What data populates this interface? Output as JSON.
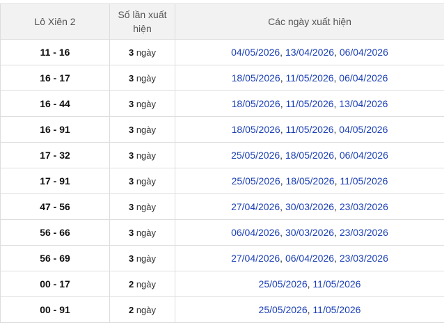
{
  "table": {
    "headers": {
      "pair": "Lô Xiên 2",
      "count": "Số lần xuất hiện",
      "dates": "Các ngày xuất hiện"
    },
    "count_suffix": " ngày",
    "date_separator": ", ",
    "rows": [
      {
        "pair": "11 - 16",
        "count": "3",
        "dates": [
          "04/05/2026",
          "13/04/2026",
          "06/04/2026"
        ]
      },
      {
        "pair": "16 - 17",
        "count": "3",
        "dates": [
          "18/05/2026",
          "11/05/2026",
          "06/04/2026"
        ]
      },
      {
        "pair": "16 - 44",
        "count": "3",
        "dates": [
          "18/05/2026",
          "11/05/2026",
          "13/04/2026"
        ]
      },
      {
        "pair": "16 - 91",
        "count": "3",
        "dates": [
          "18/05/2026",
          "11/05/2026",
          "04/05/2026"
        ]
      },
      {
        "pair": "17 - 32",
        "count": "3",
        "dates": [
          "25/05/2026",
          "18/05/2026",
          "06/04/2026"
        ]
      },
      {
        "pair": "17 - 91",
        "count": "3",
        "dates": [
          "25/05/2026",
          "18/05/2026",
          "11/05/2026"
        ]
      },
      {
        "pair": "47 - 56",
        "count": "3",
        "dates": [
          "27/04/2026",
          "30/03/2026",
          "23/03/2026"
        ]
      },
      {
        "pair": "56 - 66",
        "count": "3",
        "dates": [
          "06/04/2026",
          "30/03/2026",
          "23/03/2026"
        ]
      },
      {
        "pair": "56 - 69",
        "count": "3",
        "dates": [
          "27/04/2026",
          "06/04/2026",
          "23/03/2026"
        ]
      },
      {
        "pair": "00 - 17",
        "count": "2",
        "dates": [
          "25/05/2026",
          "11/05/2026"
        ]
      },
      {
        "pair": "00 - 91",
        "count": "2",
        "dates": [
          "25/05/2026",
          "11/05/2026"
        ]
      }
    ]
  },
  "colors": {
    "header_bg": "#f2f2f2",
    "border": "#dddddd",
    "date_link": "#1a3fb5"
  }
}
